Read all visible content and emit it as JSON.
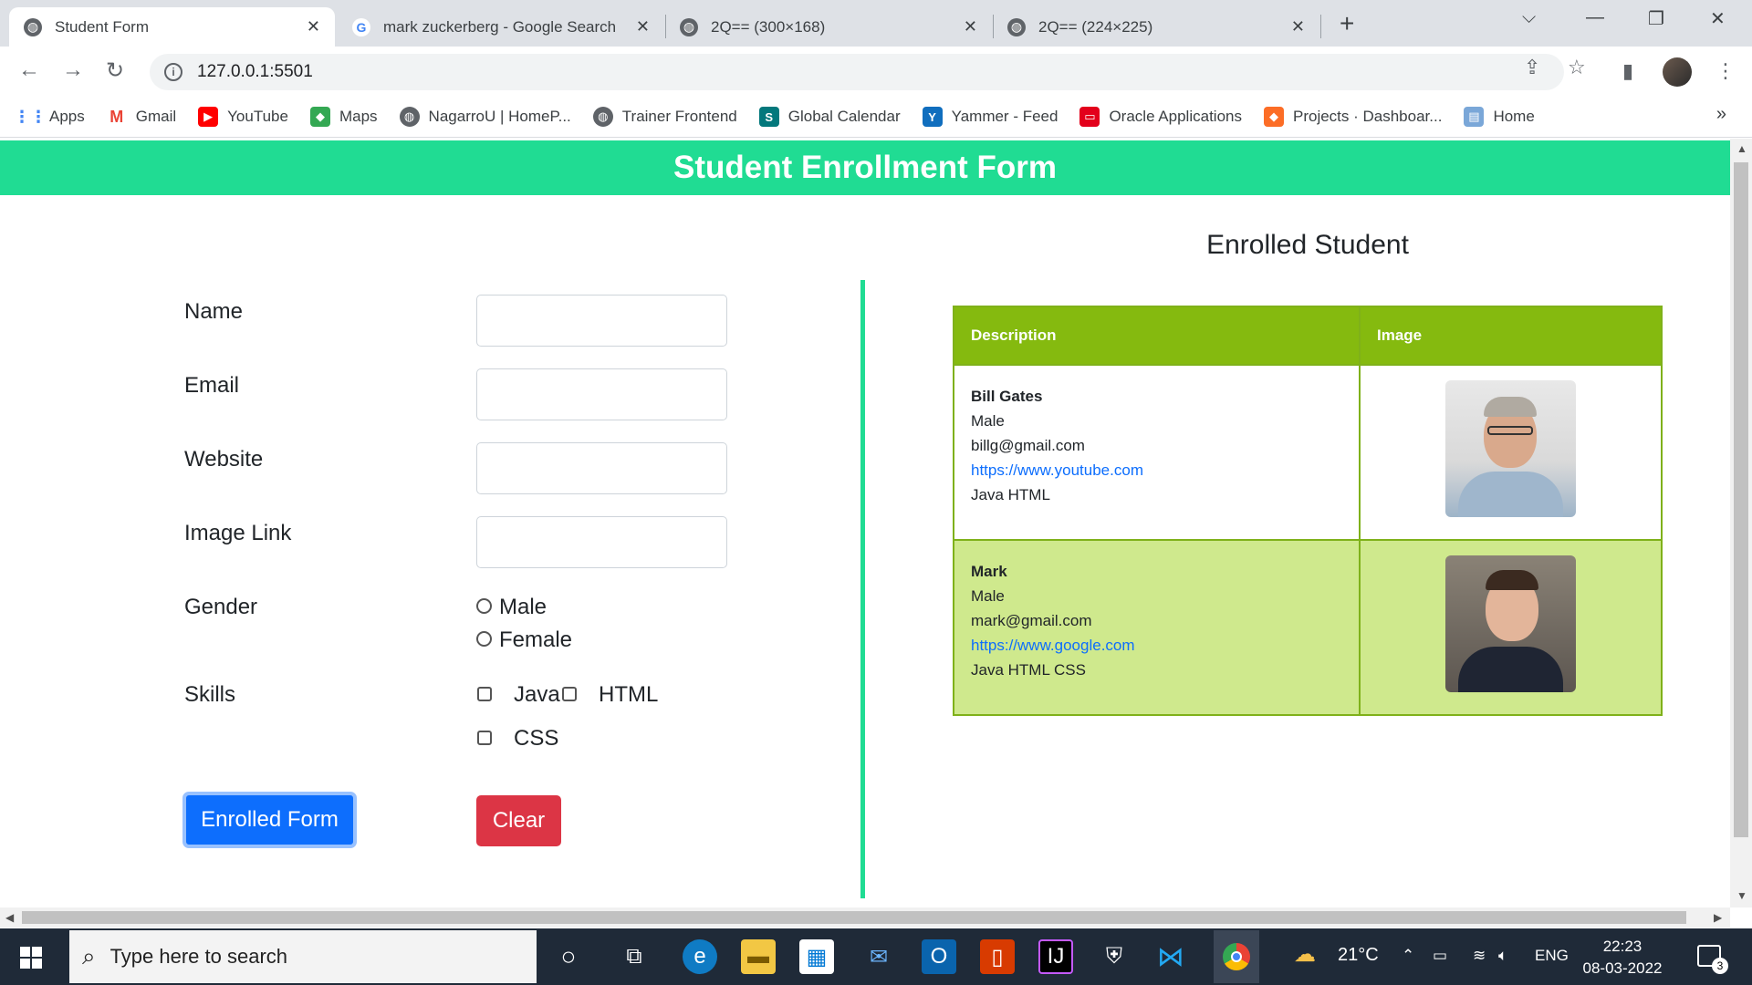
{
  "browser": {
    "tabs": [
      {
        "title": "Student Form",
        "close": "✕"
      },
      {
        "title": "mark zuckerberg - Google Search",
        "close": "✕"
      },
      {
        "title": "2Q== (300×168)",
        "close": "✕"
      },
      {
        "title": "2Q== (224×225)",
        "close": "✕"
      }
    ],
    "url": "127.0.0.1:5501",
    "bookmarks": [
      {
        "label": "Apps"
      },
      {
        "label": "Gmail"
      },
      {
        "label": "YouTube"
      },
      {
        "label": "Maps"
      },
      {
        "label": "NagarroU | HomeP..."
      },
      {
        "label": "Trainer Frontend"
      },
      {
        "label": "Global Calendar"
      },
      {
        "label": "Yammer - Feed"
      },
      {
        "label": "Oracle Applications"
      },
      {
        "label": "Projects · Dashboar..."
      },
      {
        "label": "Home"
      }
    ]
  },
  "page": {
    "banner": "Student Enrollment Form",
    "form": {
      "labels": {
        "name": "Name",
        "email": "Email",
        "website": "Website",
        "image_link": "Image Link",
        "gender": "Gender",
        "skills": "Skills"
      },
      "values": {
        "name": "",
        "email": "",
        "website": "",
        "image_link": ""
      },
      "gender_options": [
        "Male",
        "Female"
      ],
      "skill_options": [
        "Java",
        "HTML",
        "CSS"
      ],
      "submit_label": "Enrolled Form",
      "clear_label": "Clear"
    },
    "table": {
      "title": "Enrolled Student",
      "headers": [
        "Description",
        "Image"
      ],
      "rows": [
        {
          "name": "Bill Gates",
          "gender": "Male",
          "email": "billg@gmail.com",
          "website": "https://www.youtube.com",
          "skills": "Java HTML"
        },
        {
          "name": "Mark",
          "gender": "Male",
          "email": "mark@gmail.com",
          "website": "https://www.google.com",
          "skills": "Java HTML CSS"
        }
      ]
    }
  },
  "taskbar": {
    "search_placeholder": "Type here to search",
    "temperature": "21°C",
    "language": "ENG",
    "time": "22:23",
    "date": "08-03-2022",
    "notification_count": "3"
  },
  "colors": {
    "banner": "#20dc93",
    "table_header": "#85ba0f",
    "row_alt": "#cfe98d",
    "primary": "#0d6efd",
    "danger": "#dc3545"
  }
}
